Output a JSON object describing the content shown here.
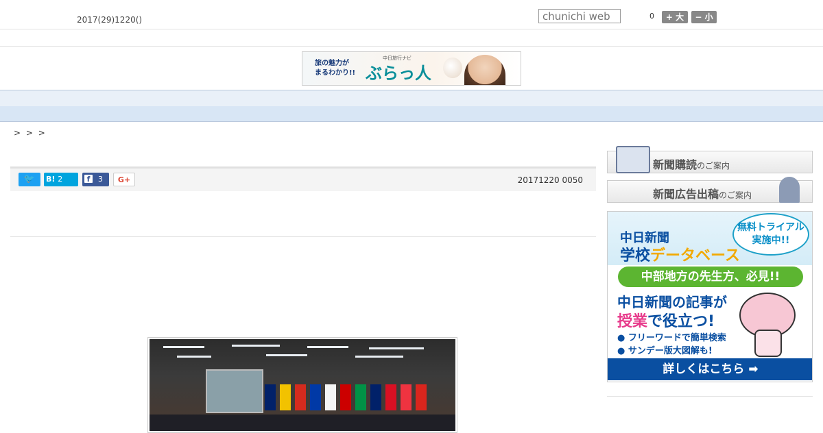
{
  "header": {
    "date": "2017(29)1220()",
    "search_placeholder": "chunichi web",
    "font_count": "0",
    "font_bigger": "+ 大",
    "font_smaller": "− 小"
  },
  "banner": {
    "tagline": "旅の魅力が\nまるわかり!!",
    "brand_small": "中日旅行ナビ",
    "brand": "ぶらっ人"
  },
  "nav": {
    "items": [
      "　　",
      "　　",
      "　　",
      "　　",
      "　　",
      "　　",
      "　　",
      "　　",
      "　　"
    ]
  },
  "breadcrumb": "> > >",
  "share": {
    "twitter_icon": "twitter-icon",
    "hatena_label": "B!",
    "hatena_count": "2",
    "facebook_count": "3",
    "gplus_label": "G+"
  },
  "article": {
    "pubdate": "20171220 0050"
  },
  "sidebar": {
    "subscribe_main": "新聞購読",
    "subscribe_suffix": "のご案内",
    "ad_main": "新聞広告出稿",
    "ad_suffix": "のご案内",
    "promo": {
      "brand": "中日新聞",
      "title_a": "学校",
      "title_b": "データベース",
      "bubble": "無料トライアル\n実施中!!",
      "green": "中部地方の先生方、必見!!",
      "line1": "中日新聞の記事が",
      "line2_a": "授業",
      "line2_b": "で役立つ!",
      "bullet1": "● フリーワードで簡単検索",
      "bullet2": "● サンデー版大図解も!",
      "cta": "詳しくはこちら ➡"
    }
  },
  "colors": {
    "nav_bg": "#e9f0f8",
    "subnav_bg": "#d8e6f5",
    "promo_blue": "#0a4fa1",
    "promo_green": "#5cb531"
  }
}
